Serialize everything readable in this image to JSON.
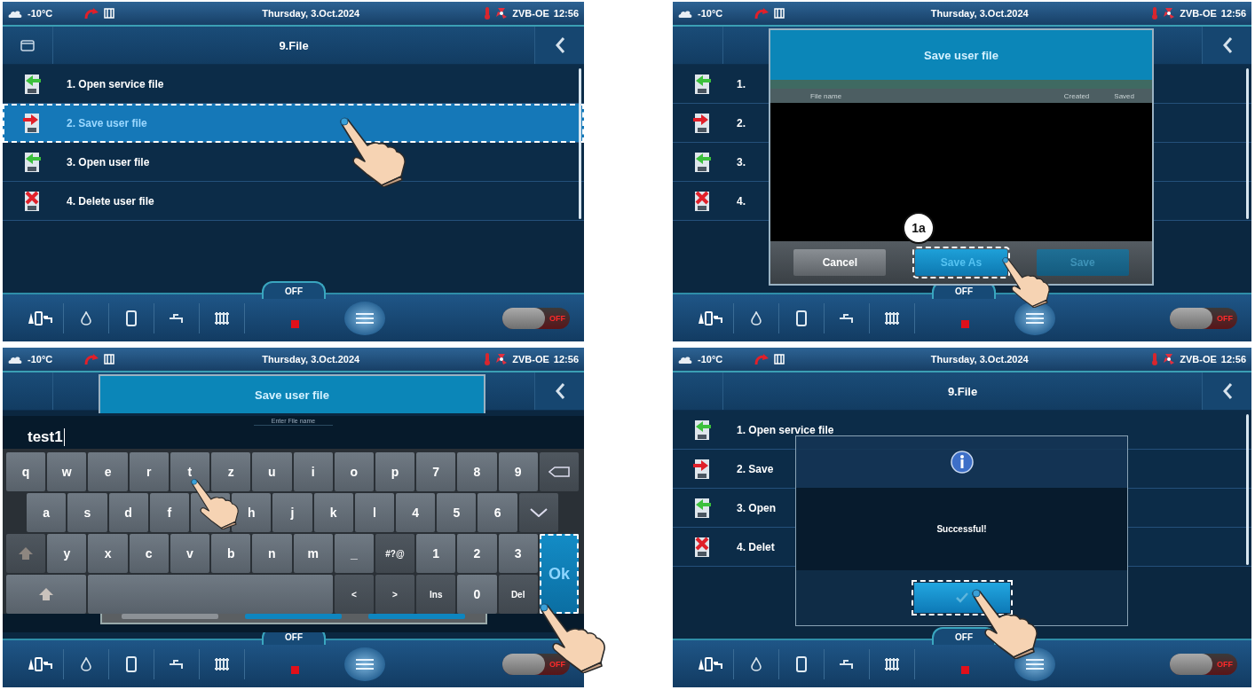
{
  "panels": [
    {
      "kind": "menu",
      "status_bar": {
        "temperature": "-10°C",
        "date": "Thursday, 3.Oct.2024",
        "device": "ZVB-OE",
        "time": "12:56"
      },
      "header": {
        "title": "9.File",
        "folder_button": true
      },
      "menu": [
        {
          "label": "1. Open service file",
          "kind": "open",
          "selected": false
        },
        {
          "label": "2. Save user file",
          "kind": "save",
          "selected": true
        },
        {
          "label": "3. Open user file",
          "kind": "open",
          "selected": false
        },
        {
          "label": "4. Delete user file",
          "kind": "delete",
          "selected": false
        }
      ],
      "bottom_bar": {
        "mode_label": "OFF",
        "switch_label": "OFF",
        "switch_on": false
      }
    },
    {
      "kind": "file_dialog",
      "status_bar": {
        "temperature": "-10°C",
        "date": "Thursday, 3.Oct.2024",
        "device": "ZVB-OE",
        "time": "12:56"
      },
      "header": {
        "folder_button": false
      },
      "menu": [
        {
          "label": "1.",
          "kind": "open",
          "selected": false
        },
        {
          "label": "2.",
          "kind": "save",
          "selected": false
        },
        {
          "label": "3.",
          "kind": "open",
          "selected": false
        },
        {
          "label": "4.",
          "kind": "delete",
          "selected": false
        }
      ],
      "dialog": {
        "title": "Save user file",
        "columns": [
          "File name",
          "Created",
          "Saved"
        ],
        "buttons": [
          {
            "label": "Cancel",
            "kind": "cancel",
            "highlighted": false,
            "disabled": false
          },
          {
            "label": "Save As",
            "kind": "confirm",
            "highlighted": true,
            "disabled": false,
            "badge": "1a"
          },
          {
            "label": "Save",
            "kind": "confirm",
            "highlighted": false,
            "disabled": true
          }
        ]
      },
      "bottom_bar": {
        "mode_label": "OFF",
        "switch_label": "OFF",
        "switch_on": false
      }
    },
    {
      "kind": "keyboard",
      "status_bar": {
        "temperature": "-10°C",
        "date": "Thursday, 3.Oct.2024",
        "device": "ZVB-OE",
        "time": "12:56"
      },
      "header": {
        "folder_button": false
      },
      "dialog_title": "Save user file",
      "field": {
        "label": "Enter File name",
        "value": "test1"
      },
      "keys": [
        [
          {
            "kind": "char",
            "label": "q"
          },
          {
            "kind": "char",
            "label": "w"
          },
          {
            "kind": "char",
            "label": "e"
          },
          {
            "kind": "char",
            "label": "r"
          },
          {
            "kind": "char",
            "label": "t"
          },
          {
            "kind": "char",
            "label": "z"
          },
          {
            "kind": "char",
            "label": "u"
          },
          {
            "kind": "char",
            "label": "i"
          },
          {
            "kind": "char",
            "label": "o"
          },
          {
            "kind": "char",
            "label": "p"
          },
          {
            "kind": "char",
            "label": "7"
          },
          {
            "kind": "char",
            "label": "8"
          },
          {
            "kind": "char",
            "label": "9"
          },
          {
            "kind": "backspace"
          }
        ],
        [
          {
            "kind": "char",
            "label": "a"
          },
          {
            "kind": "char",
            "label": "s"
          },
          {
            "kind": "char",
            "label": "d"
          },
          {
            "kind": "char",
            "label": "f"
          },
          {
            "kind": "char"
          },
          {
            "kind": "char",
            "label": "h"
          },
          {
            "kind": "char",
            "label": "j"
          },
          {
            "kind": "char",
            "label": "k"
          },
          {
            "kind": "char",
            "label": "l"
          },
          {
            "kind": "char",
            "label": "4"
          },
          {
            "kind": "char",
            "label": "5"
          },
          {
            "kind": "char",
            "label": "6"
          },
          {
            "kind": "hide"
          }
        ],
        [
          {
            "kind": "caps"
          },
          {
            "kind": "char",
            "label": "y"
          },
          {
            "kind": "char",
            "label": "x"
          },
          {
            "kind": "char",
            "label": "c"
          },
          {
            "kind": "char",
            "label": "v"
          },
          {
            "kind": "char",
            "label": "b"
          },
          {
            "kind": "char",
            "label": "n"
          },
          {
            "kind": "char",
            "label": "m"
          },
          {
            "kind": "char",
            "label": "_"
          },
          {
            "kind": "function",
            "label": "#?@"
          },
          {
            "kind": "char",
            "label": "1"
          },
          {
            "kind": "char",
            "label": "2"
          },
          {
            "kind": "char",
            "label": "3"
          },
          {
            "kind": "enter",
            "label": "Ok",
            "highlighted": true
          }
        ],
        [
          {
            "kind": "shift"
          },
          {
            "kind": "space"
          },
          {
            "kind": "function",
            "label": "<"
          },
          {
            "kind": "function",
            "label": ">"
          },
          {
            "kind": "function",
            "label": "Ins"
          },
          {
            "kind": "char",
            "label": "0"
          },
          {
            "kind": "function",
            "label": "Del"
          }
        ]
      ],
      "bottom_bar": {
        "mode_label": "OFF",
        "switch_label": "OFF",
        "switch_on": false
      }
    },
    {
      "kind": "message",
      "status_bar": {
        "temperature": "-10°C",
        "date": "Thursday, 3.Oct.2024",
        "device": "ZVB-OE",
        "time": "12:56"
      },
      "header": {
        "title": "9.File",
        "folder_button": false
      },
      "menu": [
        {
          "label": "1. Open service file",
          "kind": "open",
          "selected": false
        },
        {
          "label": "2. Save",
          "kind": "save",
          "selected": false
        },
        {
          "label": "3. Open",
          "kind": "open",
          "selected": false
        },
        {
          "label": "4. Delet",
          "kind": "delete",
          "selected": false
        }
      ],
      "message": {
        "text": "Successful!",
        "ok_highlighted": true
      },
      "bottom_bar": {
        "mode_label": "OFF",
        "switch_label": "OFF",
        "switch_on": false
      }
    }
  ]
}
